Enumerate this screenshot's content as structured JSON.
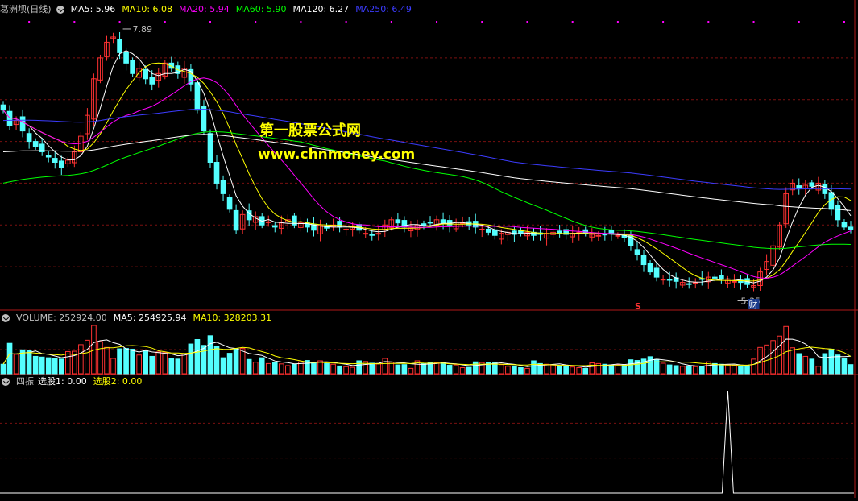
{
  "price_header": {
    "name": "葛洲坝(日线)",
    "ma": [
      {
        "label": "MA5: 5.96",
        "color": "#ffffff"
      },
      {
        "label": "MA10: 6.08",
        "color": "#ffff00"
      },
      {
        "label": "MA20: 5.94",
        "color": "#ff00ff"
      },
      {
        "label": "MA60: 5.90",
        "color": "#00ff00"
      },
      {
        "label": "MA120: 6.27",
        "color": "#ffffff"
      },
      {
        "label": "MA250: 6.49",
        "color": "#3c3cff"
      }
    ]
  },
  "volume_header": {
    "title": "VOLUME: 252924.00",
    "ma5": "MA5: 254925.94",
    "ma10": "MA10: 328203.31"
  },
  "indicator_header": {
    "name": "四振",
    "s1": "选股1: 0.00",
    "s2": "选股2: 0.00"
  },
  "watermark": {
    "line1": "第一股票公式网",
    "line2": "www.chnmoney.com"
  },
  "annotations": {
    "high_label": "7.89",
    "low_label": "5.35",
    "marker_s": "S",
    "marker_cai": "财"
  },
  "colors": {
    "up": "#ff3232",
    "down": "#54ffff",
    "grid": "#7a1010",
    "ma5": "#ffffff",
    "ma10": "#ffff00",
    "ma20": "#ff00ff",
    "ma60": "#00ff00",
    "ma120": "#ffffff",
    "ma250": "#3c3cff",
    "signal": "#ffffff"
  },
  "chart_data": {
    "type": "candlestick",
    "price_range": [
      5.2,
      8.0
    ],
    "closes": [
      7.1,
      6.95,
      7.0,
      6.9,
      6.8,
      6.75,
      6.7,
      6.65,
      6.6,
      6.55,
      6.62,
      6.7,
      6.85,
      7.05,
      7.4,
      7.6,
      7.75,
      7.8,
      7.65,
      7.55,
      7.45,
      7.5,
      7.4,
      7.35,
      7.45,
      7.55,
      7.5,
      7.45,
      7.5,
      7.35,
      7.1,
      6.9,
      6.6,
      6.4,
      6.3,
      6.15,
      5.95,
      6.1,
      6.05,
      6.08,
      6.0,
      6.03,
      5.98,
      6.02,
      6.05,
      6.0,
      6.02,
      5.98,
      5.95,
      6.0,
      5.97,
      6.0,
      5.98,
      5.96,
      5.98,
      5.95,
      5.92,
      5.9,
      5.92,
      6.0,
      6.05,
      6.02,
      5.98,
      5.97,
      6.0,
      5.99,
      6.02,
      6.05,
      6.02,
      6.0,
      6.03,
      6.02,
      6.0,
      5.98,
      5.96,
      5.93,
      5.9,
      5.92,
      5.93,
      5.91,
      5.92,
      5.93,
      5.9,
      5.91,
      5.92,
      5.93,
      5.92,
      5.91,
      5.92,
      5.93,
      5.92,
      5.91,
      5.9,
      5.91,
      5.92,
      5.9,
      5.88,
      5.8,
      5.72,
      5.62,
      5.55,
      5.5,
      5.48,
      5.47,
      5.46,
      5.45,
      5.43,
      5.45,
      5.48,
      5.5,
      5.49,
      5.48,
      5.47,
      5.46,
      5.45,
      5.43,
      5.42,
      5.55,
      5.65,
      5.8,
      6.0,
      6.3,
      6.4,
      6.35,
      6.38,
      6.37,
      6.4,
      6.3,
      6.15,
      6.05,
      5.98,
      5.96
    ]
  }
}
